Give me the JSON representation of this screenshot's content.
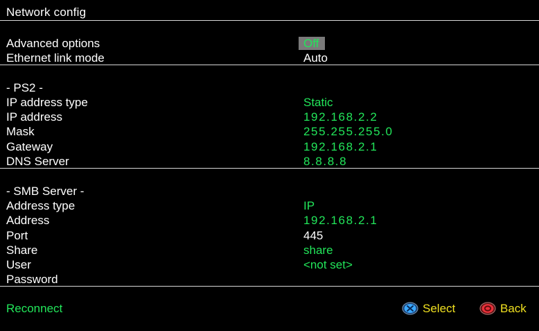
{
  "header": {
    "title": "Network config"
  },
  "general": {
    "advanced_options": {
      "label": "Advanced options",
      "value": "Off"
    },
    "ethernet_link_mode": {
      "label": "Ethernet link mode",
      "value": "Auto"
    }
  },
  "ps2": {
    "heading": "- PS2 -",
    "ip_address_type": {
      "label": "IP address type",
      "value": "Static"
    },
    "ip_address": {
      "label": "IP address",
      "value": "192.168.2.2"
    },
    "mask": {
      "label": "Mask",
      "value": "255.255.255.0"
    },
    "gateway": {
      "label": "Gateway",
      "value": "192.168.2.1"
    },
    "dns_server": {
      "label": "DNS Server",
      "value": "8.8.8.8"
    }
  },
  "smb": {
    "heading": "- SMB Server -",
    "address_type": {
      "label": "Address type",
      "value": "IP"
    },
    "address": {
      "label": "Address",
      "value": "192.168.2.1"
    },
    "port": {
      "label": "Port",
      "value": "445"
    },
    "share": {
      "label": "Share",
      "value": "share"
    },
    "user": {
      "label": "User",
      "value": "<not set>"
    },
    "password": {
      "label": "Password",
      "value": ""
    }
  },
  "footer": {
    "reconnect": "Reconnect",
    "select_label": "Select",
    "back_label": "Back",
    "select_icon": "cross-button-icon",
    "back_icon": "circle-button-icon"
  },
  "colors": {
    "background": "#000000",
    "value_green": "#22e65a",
    "hint_yellow": "#f0e020",
    "highlight_grey": "#7a7a7a",
    "cross_blue": "#3aa8ff",
    "circle_red": "#e8303a"
  }
}
